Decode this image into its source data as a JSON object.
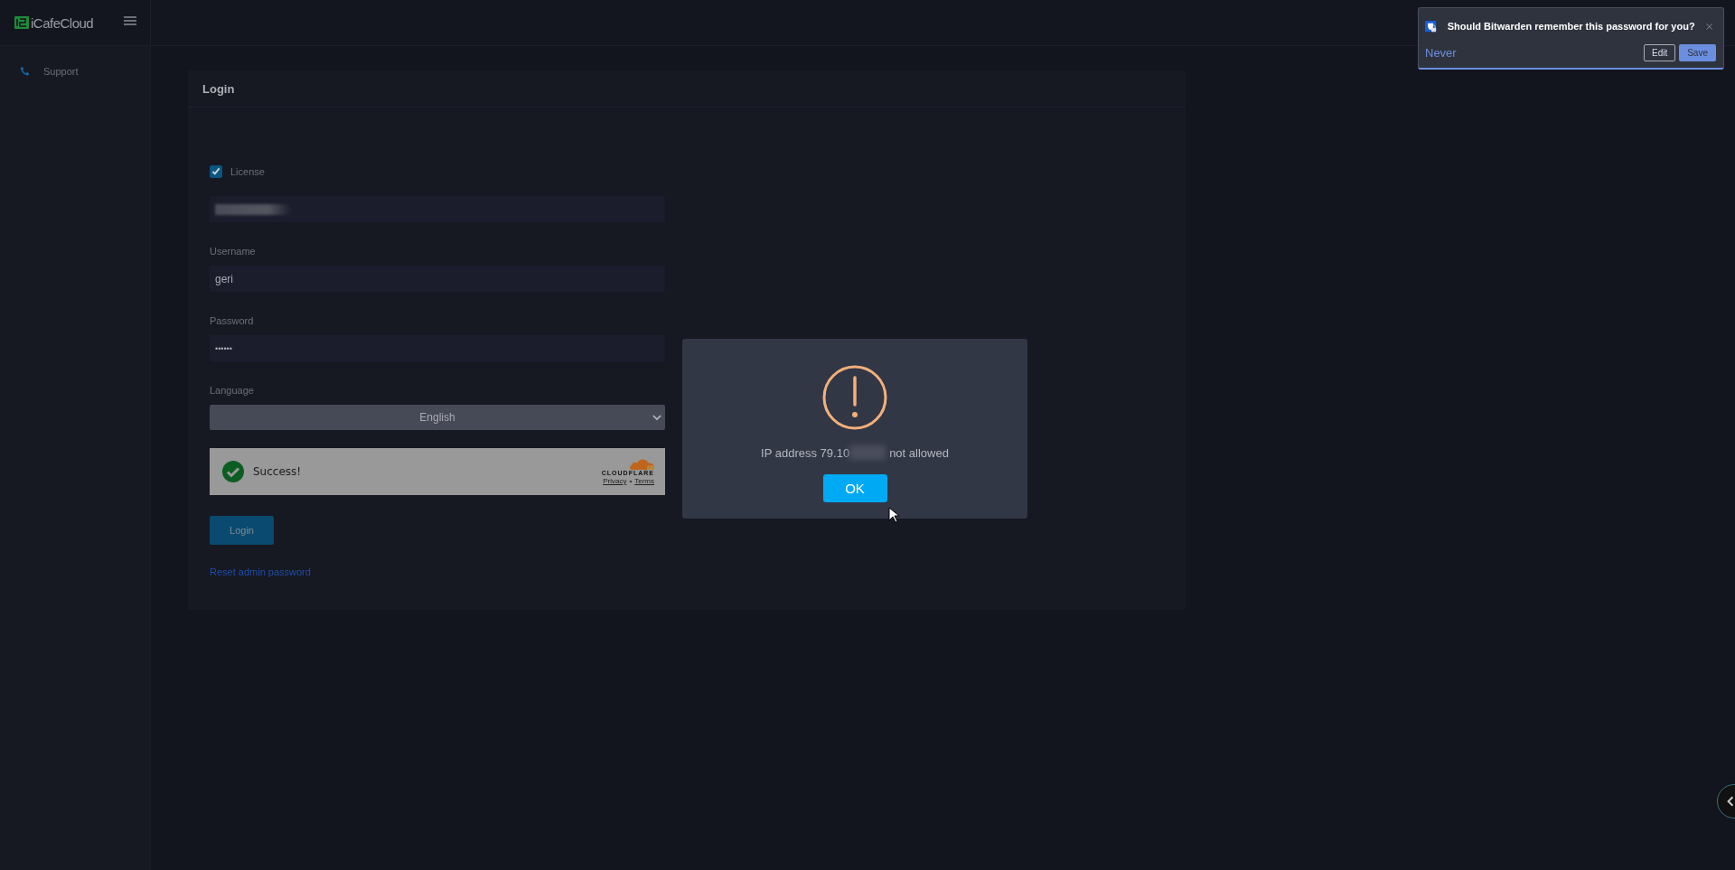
{
  "header": {
    "logo": "iCafeCloud"
  },
  "sidebar": {
    "items": [
      {
        "label": "Support",
        "selected": false
      }
    ]
  },
  "login": {
    "title": "Login",
    "license": {
      "label": "License",
      "checked": true
    },
    "license_key": {
      "redacted": true
    },
    "username": {
      "label": "Username",
      "value": "geri"
    },
    "password": {
      "label": "Password",
      "value": "••••••"
    },
    "language": {
      "label": "Language",
      "value": "English"
    },
    "captcha": {
      "status": "Success!",
      "brand": "CLOUDFLARE",
      "links": [
        "Privacy",
        "Terms"
      ],
      "separator": "•"
    },
    "submit": "Login",
    "reset_link": "Reset admin password"
  },
  "dialog": {
    "message_start": "IP address 79.10",
    "redacted": true,
    "message_end": "not allowed",
    "button": "OK"
  },
  "password_prompt": {
    "question": "Should Bitwarden remember this password for you?",
    "never": "Never",
    "buttons": [
      {
        "label": "Edit",
        "kind": "outline"
      },
      {
        "label": "Save",
        "kind": "primary"
      }
    ]
  }
}
